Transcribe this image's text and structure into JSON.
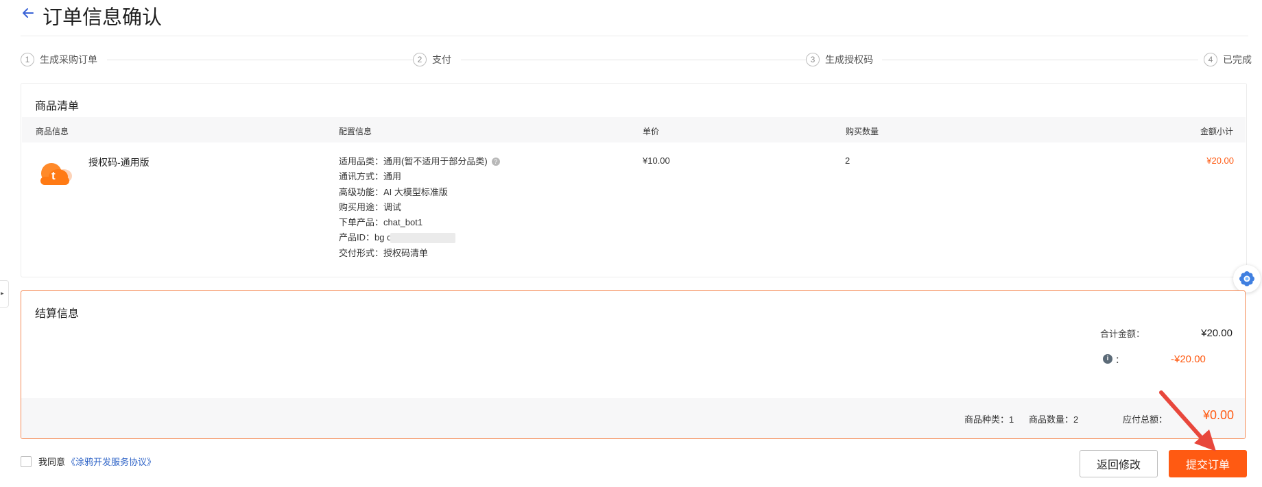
{
  "header": {
    "title": "订单信息确认"
  },
  "steps": [
    {
      "num": "1",
      "label": "生成采购订单"
    },
    {
      "num": "2",
      "label": "支付"
    },
    {
      "num": "3",
      "label": "生成授权码"
    },
    {
      "num": "4",
      "label": "已完成"
    }
  ],
  "goods": {
    "title": "商品清单",
    "columns": {
      "info": "商品信息",
      "config": "配置信息",
      "price": "单价",
      "qty": "购买数量",
      "subtotal": "金额小计"
    },
    "item": {
      "icon": "tuya-cloud-logo",
      "name": "授权码-通用版",
      "config": [
        "适用品类：通用(暂不适用于部分品类)",
        "通讯方式：通用",
        "高级功能：AI 大模型标准版",
        "购买用途：调试",
        "下单产品：chat_bot1",
        "产品ID：bg                          q",
        "交付形式：授权码清单"
      ],
      "price": "¥10.00",
      "qty": "2",
      "subtotal": "¥20.00"
    }
  },
  "settlement": {
    "title": "结算信息",
    "total_label": "合计金额：",
    "total_value": "¥20.00",
    "discount_colon": "：",
    "discount_value": "-¥20.00",
    "kinds": "商品种类：1",
    "quantity": "商品数量：2",
    "payable_label": "应付总额：",
    "payable_value": "¥0.00"
  },
  "agreement": {
    "prefix": "我同意",
    "link": "《涂鸦开发服务协议》"
  },
  "buttons": {
    "back": "返回修改",
    "submit": "提交订单"
  },
  "colors": {
    "accent": "#ff5a12",
    "link": "#2f64c7",
    "annotation_arrow": "#e8473c"
  }
}
